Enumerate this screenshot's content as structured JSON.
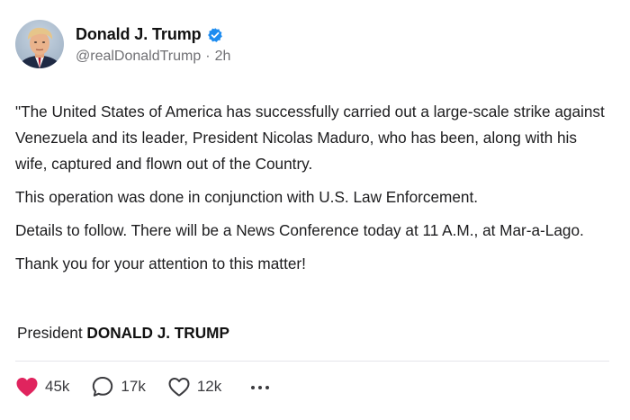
{
  "author": {
    "display_name": "Donald J. Trump",
    "handle": "@realDonaldTrump",
    "separator": "·",
    "time_ago": "2h",
    "verified_icon": "verified-check-icon",
    "verified_color": "#1d8cf0"
  },
  "post": {
    "paragraphs": [
      "\"The United States of America has successfully carried out a large-scale strike against Venezuela and its leader, President Nicolas Maduro, who has been, along with his wife, captured and flown out of the Country.",
      "This operation was done in conjunction with U.S. Law Enforcement.",
      "Details to follow. There will be a News Conference today at 11 A.M., at Mar-a-Lago.",
      "Thank you for your attention to this matter!"
    ],
    "signature_prefix": "President",
    "signature_name": "DONALD J. TRUMP"
  },
  "actions": {
    "likes": {
      "icon": "heart-icon",
      "count": "45k",
      "color": "#e0245e"
    },
    "replies": {
      "icon": "comment-icon",
      "count": "17k"
    },
    "reposts": {
      "icon": "heart-outline-icon",
      "count": "12k"
    },
    "more": {
      "icon": "more-options-icon"
    }
  }
}
